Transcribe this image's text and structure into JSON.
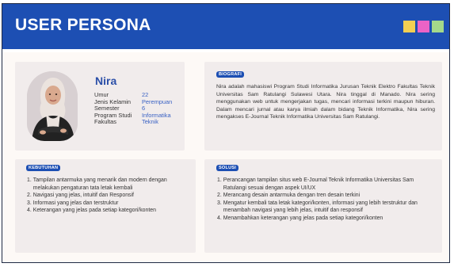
{
  "header": {
    "title": "USER PERSONA",
    "swatches": [
      "#f2cf52",
      "#eb63c6",
      "#a4d98a"
    ]
  },
  "profile": {
    "name": "Nira",
    "attributes": [
      {
        "label": "Umur",
        "value": "22"
      },
      {
        "label": "Jenis Kelamin",
        "value": "Perempuan"
      },
      {
        "label": "Semester",
        "value": "6"
      },
      {
        "label": "Program Studi",
        "value": "Informatika"
      },
      {
        "label": "Fakultas",
        "value": "Teknik"
      }
    ]
  },
  "biografi": {
    "heading": "BIOGRAFI",
    "text": "Nira adalah mahasiswi Program Studi Informatika Jurusan Teknik Elektro Fakultas Teknik Universitas Sam Ratulangi Sulawesi Utara. Nira tinggal di Manado. Nira sering menggunakan web untuk mengerjakan tugas, mencari informasi terkini maupun hiburan. Dalam mencari jurnal atau karya ilmiah dalam bidang Teknik Informatika, Nira sering mengakses E-Journal Teknik Informatika Universitas Sam Ratulangi."
  },
  "kebutuhan": {
    "heading": "KEBUTUHAN",
    "items": [
      {
        "num": "1.",
        "text": "Tampilan antarmuka yang menarik dan modern dengan melakukan pengaturan tata letak kembali"
      },
      {
        "num": "2.",
        "text": "Navigasi yang jelas, intuitif dan Responsif"
      },
      {
        "num": "3.",
        "text": "Informasi yang jelas dan terstruktur"
      },
      {
        "num": "4.",
        "text": "Keterangan yang jelas pada setiap kategori/konten"
      }
    ]
  },
  "solusi": {
    "heading": "SOLUSI",
    "items": [
      {
        "num": "1.",
        "text": "Perancangan tampilan situs web E-Journal Teknik Informatika Universitas Sam Ratulangi sesuai dengan aspek UI/UX"
      },
      {
        "num": "2.",
        "text": "Merancang desain antarmuka dengan tren desain terkini"
      },
      {
        "num": "3.",
        "text": "Mengatur kembali tata letak kategori/konten, informasi yang lebih terstruktur dan menambah navigasi yang lebih jelas, intuitif dan responsif"
      },
      {
        "num": "4.",
        "text": "Menambahkan keterangan yang jelas pada setiap kategori/konten"
      }
    ]
  }
}
